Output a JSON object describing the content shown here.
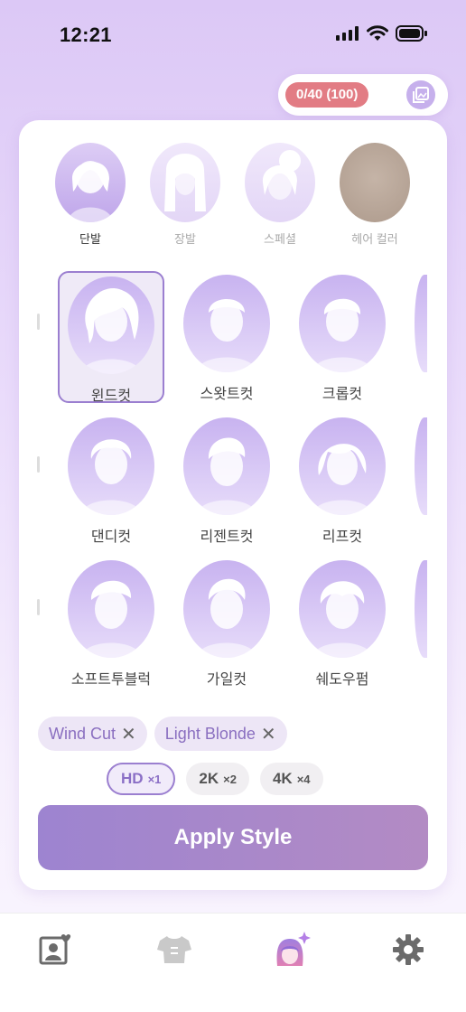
{
  "status": {
    "time": "12:21"
  },
  "credits": {
    "text": "0/40 (100)"
  },
  "categories": [
    {
      "label": "단발"
    },
    {
      "label": "장발"
    },
    {
      "label": "스페셜"
    },
    {
      "label": "헤어 컬러"
    }
  ],
  "styles": [
    {
      "label": "윈드컷"
    },
    {
      "label": "스왓트컷"
    },
    {
      "label": "크롭컷"
    },
    {
      "label": "댄디컷"
    },
    {
      "label": "리젠트컷"
    },
    {
      "label": "리프컷"
    },
    {
      "label": "소프트투블럭"
    },
    {
      "label": "가일컷"
    },
    {
      "label": "쉐도우펌"
    }
  ],
  "selected_chips": [
    {
      "label": "Wind Cut"
    },
    {
      "label": "Light Blonde"
    }
  ],
  "quality": [
    {
      "label": "HD",
      "mult": "×1"
    },
    {
      "label": "2K",
      "mult": "×2"
    },
    {
      "label": "4K",
      "mult": "×4"
    }
  ],
  "apply_label": "Apply Style",
  "colors": {
    "accent": "#9b7fd0",
    "credits_badge": "#e27c84"
  },
  "tabs": [
    "profile-heart-icon",
    "shirt-icon",
    "avatar-sparkle-icon",
    "gear-icon"
  ]
}
